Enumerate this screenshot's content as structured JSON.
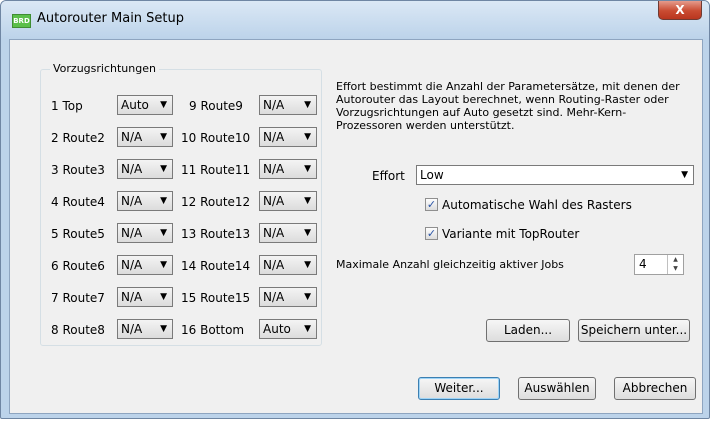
{
  "window": {
    "title": "Autorouter Main Setup",
    "app_icon_text": "BRD",
    "close_glyph": "X"
  },
  "group": {
    "label": "Vorzugsrichtungen",
    "left": [
      {
        "label": "1 Top",
        "value": "Auto"
      },
      {
        "label": "2 Route2",
        "value": "N/A"
      },
      {
        "label": "3 Route3",
        "value": "N/A"
      },
      {
        "label": "4 Route4",
        "value": "N/A"
      },
      {
        "label": "5 Route5",
        "value": "N/A"
      },
      {
        "label": "6 Route6",
        "value": "N/A"
      },
      {
        "label": "7 Route7",
        "value": "N/A"
      },
      {
        "label": "8 Route8",
        "value": "N/A"
      }
    ],
    "right": [
      {
        "label": "9 Route9",
        "value": "N/A"
      },
      {
        "label": "10 Route10",
        "value": "N/A"
      },
      {
        "label": "11 Route11",
        "value": "N/A"
      },
      {
        "label": "12 Route12",
        "value": "N/A"
      },
      {
        "label": "13 Route13",
        "value": "N/A"
      },
      {
        "label": "14 Route14",
        "value": "N/A"
      },
      {
        "label": "15 Route15",
        "value": "N/A"
      },
      {
        "label": "16 Bottom",
        "value": "Auto"
      }
    ]
  },
  "description": "Effort bestimmt die Anzahl der Parametersätze, mit denen der Autorouter das Layout berechnet, wenn Routing-Raster oder Vorzugsrichtungen auf Auto gesetzt sind. Mehr-Kern-Prozessoren werden unterstützt.",
  "effort": {
    "label": "Effort",
    "value": "Low"
  },
  "options": {
    "auto_grid": {
      "label": "Automatische Wahl des Rasters",
      "checked": true
    },
    "toprouter": {
      "label": "Variante mit TopRouter",
      "checked": true
    }
  },
  "jobs": {
    "label": "Maximale Anzahl gleichzeitig aktiver Jobs",
    "value": "4"
  },
  "buttons": {
    "load": "Laden...",
    "save_as": "Speichern unter...",
    "next": "Weiter...",
    "select": "Auswählen",
    "cancel": "Abbrechen"
  },
  "glyphs": {
    "dropdown": "▼",
    "spin_up": "▲",
    "spin_down": "▼",
    "check": "✓"
  }
}
